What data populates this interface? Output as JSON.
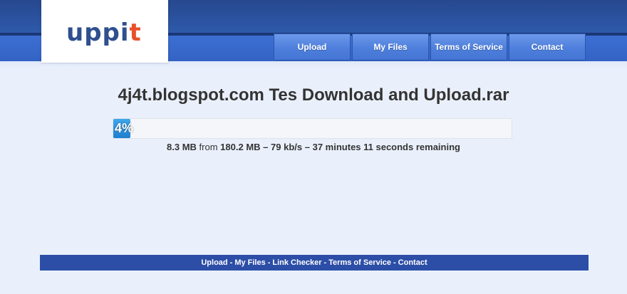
{
  "logo": {
    "text_main": "uppi",
    "text_accent": "t"
  },
  "nav": {
    "items": [
      "Upload",
      "My Files",
      "Terms of Service",
      "Contact"
    ]
  },
  "file": {
    "title": "4j4t.blogspot.com Tes Download and Upload.rar"
  },
  "progress": {
    "percent": 4,
    "label": "4%",
    "downloaded": "8.3 MB",
    "from_label": "from",
    "total": "180.2 MB",
    "separator": "–",
    "speed": "79 kb/s",
    "remaining": "37 minutes 11 seconds remaining"
  },
  "footer": {
    "links": [
      "Upload",
      "My Files",
      "Link Checker",
      "Terms of Service",
      "Contact"
    ],
    "separator": "-"
  },
  "colors": {
    "header_blue": "#2f56a3",
    "nav_button": "#4e7fdc",
    "logo_text": "#2f4f8f",
    "logo_accent": "#e8502b",
    "progress_fill": "#1d7fd0",
    "footer_bg": "#2c4ea7"
  }
}
